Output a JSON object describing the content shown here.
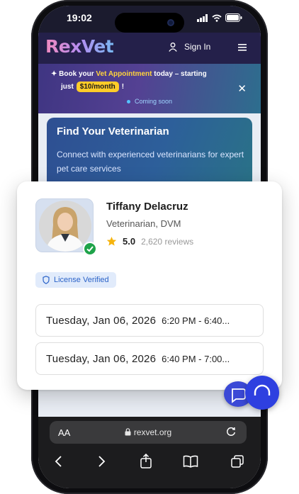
{
  "status": {
    "time": "19:02"
  },
  "nav": {
    "logo": "RexVet",
    "signin": "Sign In"
  },
  "banner": {
    "prefix": "Book your ",
    "highlight": "Vet Appointment",
    "suffix": " today – starting",
    "just": "just",
    "price": "$10/month",
    "bang": "!",
    "soon": "Coming soon"
  },
  "hero": {
    "title": "Find Your Veterinarian",
    "subtitle": "Connect with experienced veterinarians for expert pet care services"
  },
  "vet": {
    "name": "Tiffany Delacruz",
    "role": "Veterinarian, DVM",
    "rating": "5.0",
    "reviews": "2,620 reviews",
    "badge": "License Verified"
  },
  "slots": [
    {
      "date": "Tuesday, Jan 06, 2026",
      "time": "6:20 PM - 6:40..."
    },
    {
      "date": "Tuesday, Jan 06, 2026",
      "time": "6:40 PM - 7:00..."
    }
  ],
  "browser": {
    "aa": "AA",
    "url": "rexvet.org"
  },
  "colors": {
    "accent": "#2e40e0",
    "verified": "#1ea34a",
    "highlight": "#ffcc29"
  },
  "icons": [
    "signal-icon",
    "wifi-icon",
    "battery-icon",
    "user-icon",
    "hamburger-icon",
    "close-icon",
    "star-icon",
    "shield-icon",
    "check-icon",
    "lock-icon",
    "reload-icon",
    "back-icon",
    "forward-icon",
    "share-icon",
    "bookmarks-icon",
    "tabs-icon",
    "chat-icon"
  ]
}
